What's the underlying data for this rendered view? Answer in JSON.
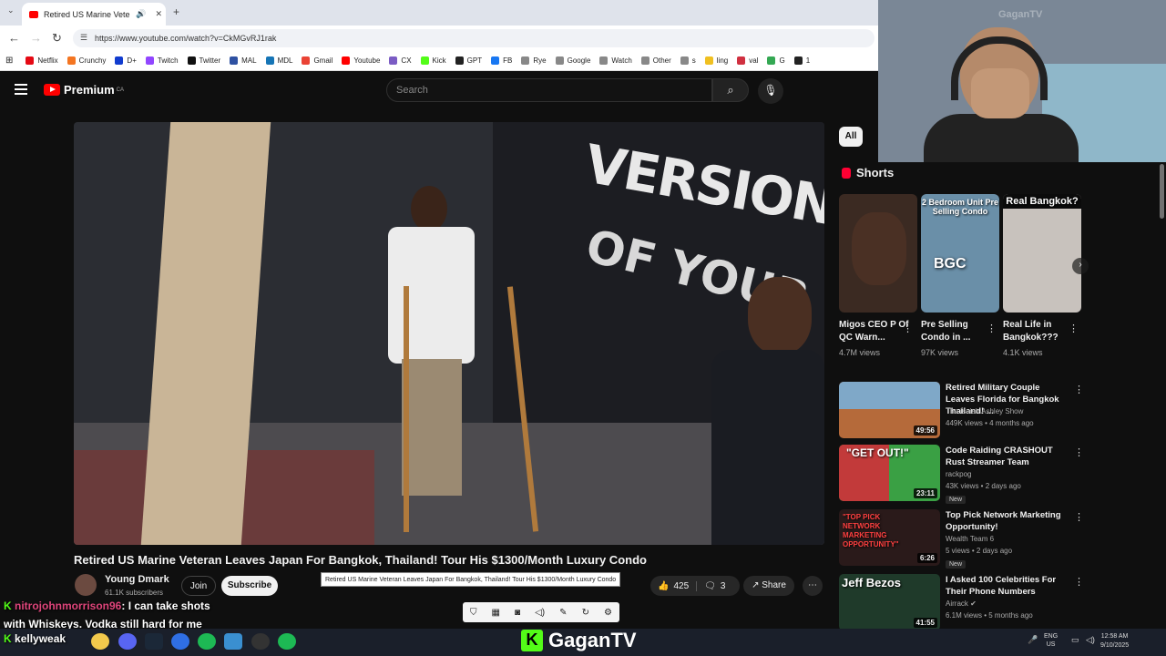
{
  "browser": {
    "tab_title": "Retired US Marine Veteran",
    "url": "https://www.youtube.com/watch?v=CkMGvRJ1rak",
    "bookmarks": [
      {
        "label": "Netflix",
        "color": "#e50914"
      },
      {
        "label": "Crunchy",
        "color": "#f47521"
      },
      {
        "label": "D+",
        "color": "#113ccf"
      },
      {
        "label": "Twitch",
        "color": "#9146ff"
      },
      {
        "label": "Twitter",
        "color": "#111111"
      },
      {
        "label": "MAL",
        "color": "#2e51a2"
      },
      {
        "label": "MDL",
        "color": "#1675b6"
      },
      {
        "label": "Gmail",
        "color": "#ea4335"
      },
      {
        "label": "Youtube",
        "color": "#ff0000"
      },
      {
        "label": "CX",
        "color": "#7b5cc4"
      },
      {
        "label": "Kick",
        "color": "#53fc18"
      },
      {
        "label": "GPT",
        "color": "#222222"
      },
      {
        "label": "FB",
        "color": "#1877f2"
      },
      {
        "label": "Rye",
        "color": "#888888"
      },
      {
        "label": "Google",
        "color": "#888888"
      },
      {
        "label": "Watch",
        "color": "#888888"
      },
      {
        "label": "Other",
        "color": "#888888"
      },
      {
        "label": "s",
        "color": "#888888"
      },
      {
        "label": "ling",
        "color": "#f0c020"
      },
      {
        "label": "val",
        "color": "#d03040"
      },
      {
        "label": "G",
        "color": "#34a853"
      },
      {
        "label": "1",
        "color": "#222222"
      }
    ]
  },
  "youtube": {
    "logo_text": "Premium",
    "logo_region": "CA",
    "search_placeholder": "Search"
  },
  "video": {
    "wall_text_1": "VERSION",
    "wall_text_2": "OF YOUR",
    "title": "Retired US Marine Veteran Leaves Japan For Bangkok, Thailand! Tour His $1300/Month Luxury Condo",
    "tooltip": "Retired US Marine Veteran Leaves Japan For Bangkok, Thailand! Tour His $1300/Month Luxury Condo",
    "channel": "Young Dmark",
    "subscribers": "61.1K subscribers",
    "join_label": "Join",
    "subscribe_label": "Subscribe",
    "likes": "425",
    "dislikes": "3",
    "share_label": "Share"
  },
  "chat": {
    "username": "nitrojohnmorrison96",
    "message_1": ": I can take shots",
    "message_2": "with Whiskeys. Vodka still hard for me",
    "kick_user": "kellyweak"
  },
  "sidebar": {
    "chip_all": "All",
    "shorts_heading": "Shorts",
    "shorts": [
      {
        "title": "Migos CEO P Of QC Warn...",
        "views": "4.7M views",
        "caption": "",
        "bg": "#3b2a22"
      },
      {
        "title": "Pre Selling Condo in ...",
        "views": "97K views",
        "caption": "2 Bedroom Unit Pre Selling Condo",
        "overlay": "BGC",
        "bg": "#6a8fa8"
      },
      {
        "title": "Real Life in Bangkok???",
        "views": "4.1K views",
        "caption": "Real Bangkok?",
        "bg": "#c8c2bd"
      }
    ],
    "recommendations": [
      {
        "title": "Retired Military Couple Leaves Florida for Bangkok Thailand! ...",
        "channel": "The Isaiah Ashley Show",
        "meta": "449K views • 4 months ago",
        "duration": "49:56",
        "new": "",
        "bg": "#b56a3a"
      },
      {
        "title": "Code Raiding CRASHOUT Rust Streamer Team",
        "channel": "rackpog",
        "meta": "43K views • 2 days ago",
        "duration": "23:11",
        "new": "New",
        "bg": "#3aa044",
        "caption": "\"GET OUT!\""
      },
      {
        "title": "Top Pick Network Marketing Opportunity!",
        "channel": "Wealth Team 6",
        "meta": "5 views • 2 days ago",
        "duration": "6:26",
        "new": "New",
        "bg": "#2a1a1a",
        "caption": "\"TOP PICK NETWORK MARKETING OPPORTUNITY\""
      },
      {
        "title": "I Asked 100 Celebrities For Their Phone Numbers",
        "channel": "Airrack",
        "meta": "6.1M views • 5 months ago",
        "duration": "41:55",
        "new": "",
        "bg": "#1f3a2a",
        "caption": "Jeff Bezos"
      }
    ]
  },
  "webcam": {
    "watermark": "GaganTV"
  },
  "taskbar": {
    "brand": "GaganTV",
    "lang_1": "ENG",
    "lang_2": "US",
    "time": "12:58 AM",
    "date": "9/10/2025"
  }
}
